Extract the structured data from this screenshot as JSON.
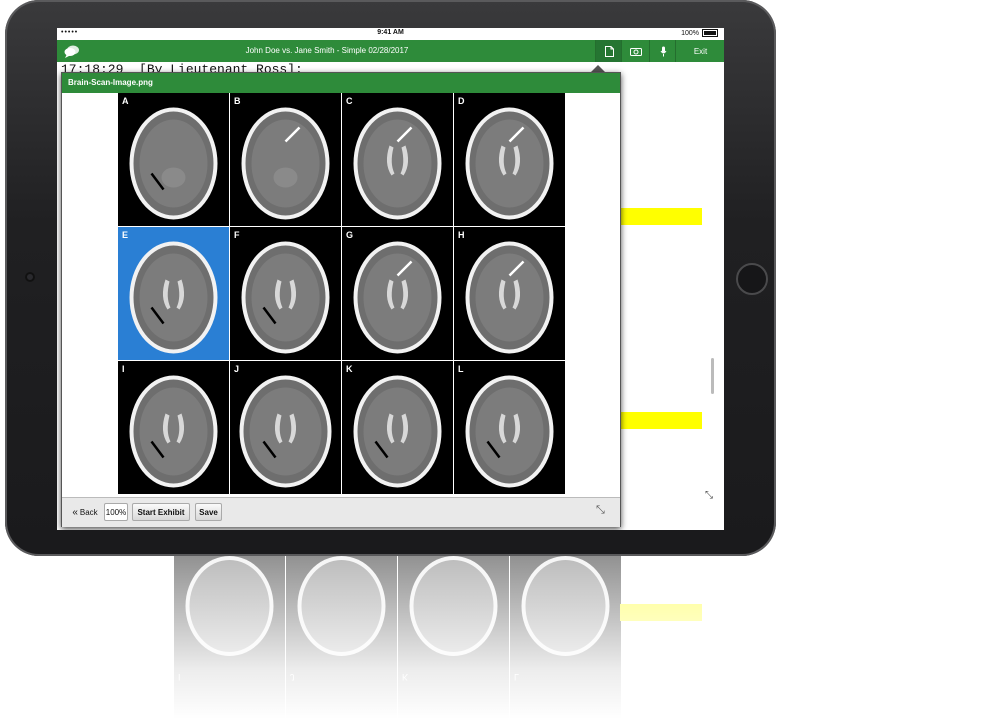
{
  "status_bar": {
    "signal": "•••••",
    "time": "9:41 AM",
    "battery": "100%"
  },
  "app_header": {
    "case_title": "John Doe vs. Jane Smith - Simple 02/28/2017",
    "exit_label": "Exit",
    "icons": [
      "chat-bubble-icon",
      "document-icon",
      "camera-icon",
      "microphone-icon"
    ]
  },
  "transcript": {
    "line": "17:18:29  [By Lieutenant Ross]:",
    "highlight_color": "#ffff00"
  },
  "exhibit": {
    "filename": "Brain-Scan-Image.png",
    "panels": [
      "A",
      "B",
      "C",
      "D",
      "E",
      "F",
      "G",
      "H",
      "I",
      "J",
      "K",
      "L"
    ],
    "highlighted_panel": "E",
    "highlight_color": "#2a7fd4"
  },
  "toolbar": {
    "back_label": "Back",
    "zoom_label": "100%",
    "start_exhibit_label": "Start Exhibit",
    "save_label": "Save"
  },
  "colors": {
    "brand_green": "#2e8b3a",
    "device_frame": "#1e1e20"
  }
}
